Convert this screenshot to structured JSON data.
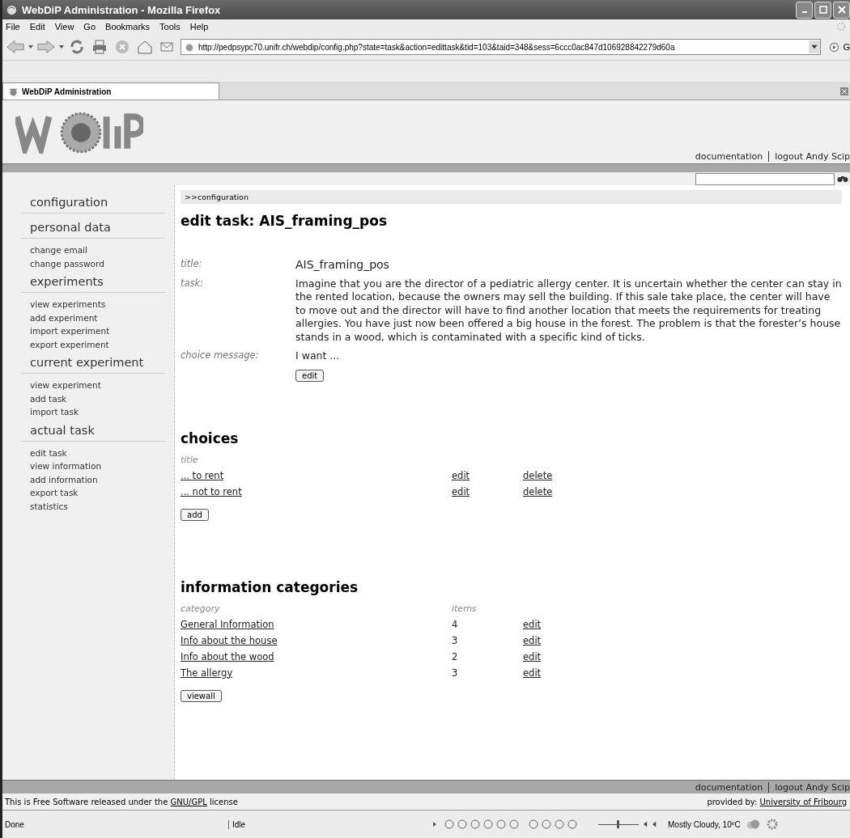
{
  "window": {
    "title": "WebDiP Administration - Mozilla Firefox"
  },
  "menu": [
    "File",
    "Edit",
    "View",
    "Go",
    "Bookmarks",
    "Tools",
    "Help"
  ],
  "address": {
    "value": "http://pedpsypc70.unifr.ch/webdip/config.php?state=task&action=edittask&tid=103&taid=348&sess=6ccc0ac847d106928842279d60a",
    "go": "G"
  },
  "tabs": [
    {
      "label": "WebDiP Administration",
      "selected": true
    }
  ],
  "header": {
    "links": [
      "documentation",
      "logout Andy Scip"
    ]
  },
  "sidebar": [
    {
      "heading": "configuration"
    },
    {
      "heading": "personal data",
      "items": [
        "change email",
        "change password"
      ]
    },
    {
      "heading": "experiments",
      "items": [
        "view experiments",
        "add experiment",
        "import experiment",
        "export experiment"
      ]
    },
    {
      "heading": "current experiment",
      "items": [
        "view experiment",
        "add task",
        "import task"
      ]
    },
    {
      "heading": "actual task",
      "items": [
        "edit task",
        "view information",
        "add information",
        "export task",
        "statistics"
      ]
    }
  ],
  "breadcrumb": ">>configuration",
  "page_title": "edit task: AIS_framing_pos",
  "fields": [
    {
      "label": "title:",
      "value": "AIS_framing_pos"
    },
    {
      "label": "task:",
      "value": "Imagine that you are the director of a pediatric allergy center. It is uncertain whether the center can stay in the rented location, because the owners may sell the building. If this sale take place, the center will have to move out and the director will have to find another location that meets the requirements for treating allergies. You have just now been offered a big house in the forest. The problem is that the forester’s house stands in a wood, which is contaminated with a specific kind of ticks."
    },
    {
      "label": "choice message:",
      "value": "I want ..."
    }
  ],
  "edit_button": "edit",
  "choices": {
    "heading": "choices",
    "column": "title",
    "rows": [
      {
        "title": "... to rent",
        "edit": "edit",
        "delete": "delete"
      },
      {
        "title": "... not to rent",
        "edit": "edit",
        "delete": "delete"
      }
    ],
    "add_button": "add"
  },
  "categories": {
    "heading": "information categories",
    "columns": [
      "category",
      "items"
    ],
    "rows": [
      {
        "category": "General Information",
        "items": "4",
        "edit": "edit"
      },
      {
        "category": "Info about the house",
        "items": "3",
        "edit": "edit"
      },
      {
        "category": "Info about the wood",
        "items": "2",
        "edit": "edit"
      },
      {
        "category": "The allergy",
        "items": "3",
        "edit": "edit"
      }
    ],
    "viewall_button": "viewall"
  },
  "footer": {
    "links": [
      "documentation",
      "logout Andy Scip"
    ],
    "license": {
      "before": "This is Free Software released under the ",
      "link": "GNU/GPL",
      "after": " license"
    },
    "provided_label": "provided by: ",
    "provided_link": "University of Fribourg"
  },
  "status_bar": {
    "left": "Done",
    "middle": "Idle",
    "weather": "Mostly Cloudy, 10ºC",
    "volume": {
      "level": 0.45
    }
  }
}
